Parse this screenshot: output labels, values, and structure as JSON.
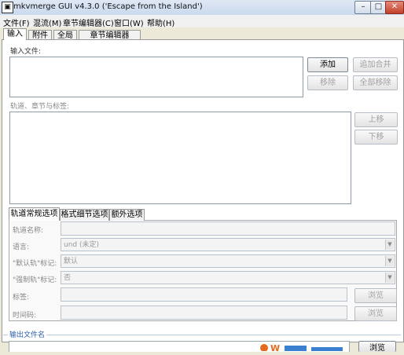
{
  "window": {
    "title": "mkvmerge GUI v4.3.0 ('Escape from the Island')",
    "min_label": "–",
    "max_label": "□",
    "close_label": "✕"
  },
  "menu": [
    "文件(F)",
    "混流(M)",
    "章节编辑器(C)",
    "窗口(W)",
    "帮助(H)"
  ],
  "tabs": [
    "输入",
    "附件",
    "全局",
    "章节编辑器"
  ],
  "input": {
    "files_label": "输入文件:",
    "add": "添加",
    "append": "追加合并",
    "remove": "移除",
    "remove_all": "全部移除",
    "tracks_label": "轨道、章节与标签:",
    "up": "上移",
    "down": "下移"
  },
  "subtabs": [
    "轨道常规选项",
    "格式细节选项",
    "额外选项"
  ],
  "options": {
    "track_name": {
      "label": "轨道名称:",
      "value": ""
    },
    "language": {
      "label": "语言:",
      "value": "und (未定)"
    },
    "default_track": {
      "label": "\"默认轨\"标记:",
      "value": "默认"
    },
    "forced_track": {
      "label": "\"强制轨\"标记:",
      "value": "否"
    },
    "tags": {
      "label": "标签:",
      "value": "",
      "browse": "浏览"
    },
    "timecodes": {
      "label": "时间码:",
      "value": "",
      "browse": "浏览"
    }
  },
  "output": {
    "legend": "输出文件名",
    "browse": "浏览"
  },
  "colors": {
    "accent": "#2a5ea8",
    "window_bg": "#ece9d8"
  }
}
